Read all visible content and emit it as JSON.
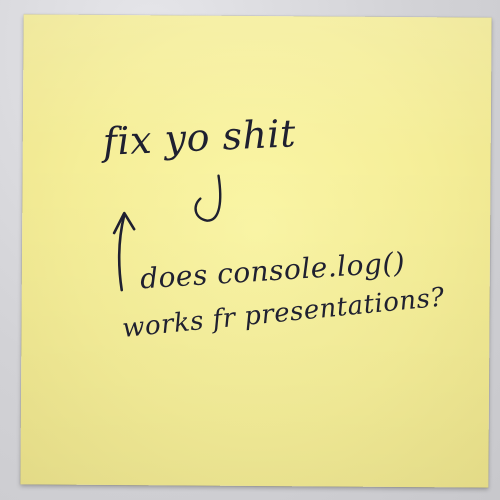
{
  "note": {
    "line1": "fix yo shit",
    "line2": "does console.log()",
    "line3": "works fr presentations?",
    "paper_color": "#f5ee98",
    "ink_color": "#1f2030",
    "background_color": "#d9d9dc"
  }
}
